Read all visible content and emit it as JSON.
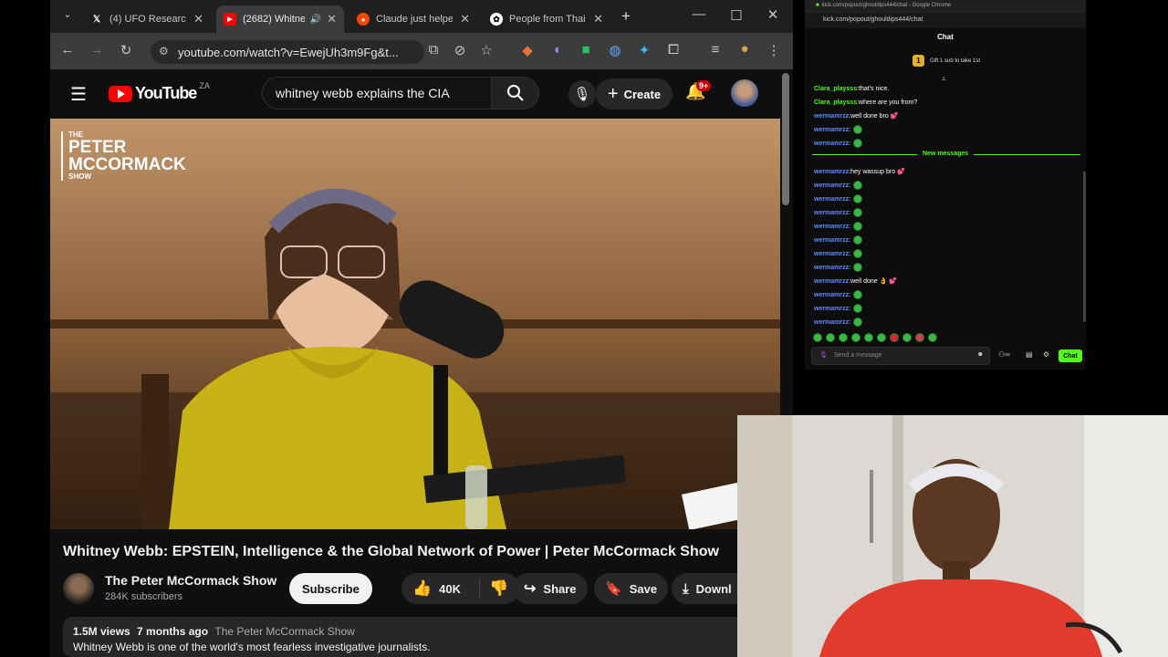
{
  "browser": {
    "tabs": [
      {
        "title": "(4) UFO Researche",
        "favicon": "x-logo"
      },
      {
        "title": "(2682) Whitne",
        "favicon": "youtube-logo",
        "active": true
      },
      {
        "title": "Claude just helpe",
        "favicon": "reddit-logo"
      },
      {
        "title": "People from Thai",
        "favicon": "chatgpt-logo"
      }
    ],
    "new_tab": "+",
    "url": "youtube.com/watch?v=EwejUh3m9Fg&t..."
  },
  "youtube": {
    "logo_text": "YouTube",
    "region": "ZA",
    "search_value": "whitney webb explains the CIA",
    "create_label": "Create",
    "notifications_badge": "9+",
    "video_watermark": [
      "THE",
      "PETER",
      "MCCORMACK",
      "SHOW"
    ],
    "video_title": "Whitney Webb: EPSTEIN, Intelligence & the Global Network of Power | Peter McCormack Show",
    "channel_name": "The Peter McCormack Show",
    "subscribers": "284K subscribers",
    "subscribe_label": "Subscribe",
    "likes": "40K",
    "share_label": "Share",
    "save_label": "Save",
    "download_label": "Downl",
    "views": "1.5M views",
    "age": "7 months ago",
    "desc_channel": "The Peter McCormack Show",
    "description": "Whitney Webb is one of the world's most fearless investigative journalists."
  },
  "kick": {
    "window_title": "kick.com/popout/ghouldips444/chat - Google Chrome",
    "url": "kick.com/popout/ghouldips444/chat",
    "chat_title": "Chat",
    "gift_text": "Gift 1 sub to take 1st",
    "gift_count": "1",
    "new_messages_label": "New messages",
    "messages": [
      {
        "user": "Clara_playsss",
        "text": "that's nice.",
        "green": true
      },
      {
        "user": "Clara_playsss",
        "text": "where are you from?",
        "green": true
      },
      {
        "user": "wermamrzz",
        "text": "well done bro 💕"
      },
      {
        "user": "wermamrzz",
        "text": "",
        "emote": true
      },
      {
        "user": "wermamrzz",
        "text": "",
        "emote": true
      },
      {
        "user": "wermamrzz",
        "text": "hey wassup bro 💕"
      },
      {
        "user": "wermamrzz",
        "text": "",
        "emote": true
      },
      {
        "user": "wermamrzz",
        "text": "",
        "emote": true
      },
      {
        "user": "wermamrzz",
        "text": "",
        "emote": true
      },
      {
        "user": "wermamrzz",
        "text": "",
        "emote": true
      },
      {
        "user": "wermamrzz",
        "text": "",
        "emote": true
      },
      {
        "user": "wermamrzz",
        "text": "",
        "emote": true
      },
      {
        "user": "wermamrzz",
        "text": "",
        "emote": true
      },
      {
        "user": "wermamrzz",
        "text": "well done 👌 💕"
      },
      {
        "user": "wermamrzz",
        "text": "",
        "emote": true
      },
      {
        "user": "wermamrzz",
        "text": "",
        "emote": true
      },
      {
        "user": "wermamrzz",
        "text": "",
        "emote": true
      }
    ],
    "input_placeholder": "Send a message",
    "chat_button": "Chat"
  }
}
